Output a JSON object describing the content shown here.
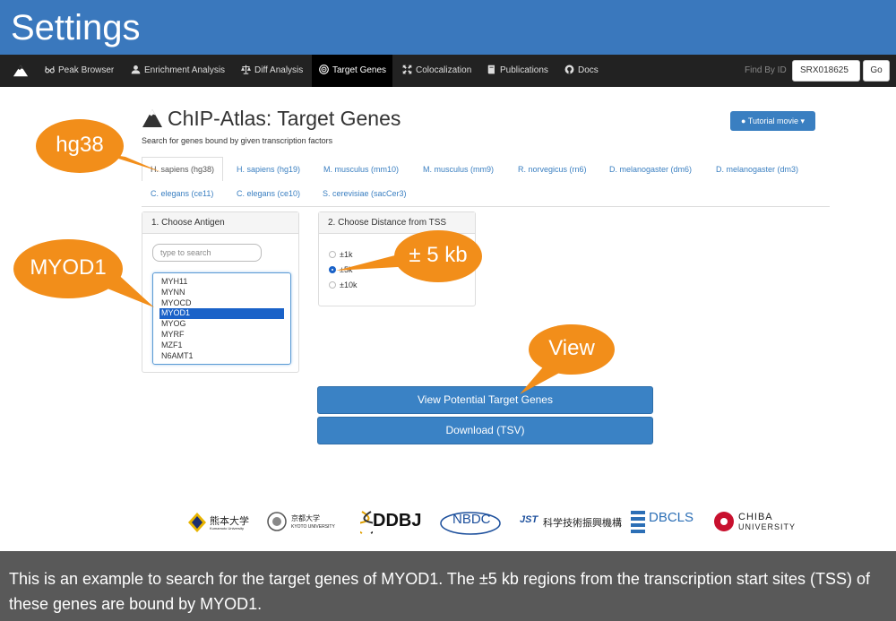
{
  "banner": {
    "title": "Settings"
  },
  "nav": {
    "items": [
      {
        "label": "Peak Browser",
        "icon": "glasses-icon"
      },
      {
        "label": "Enrichment Analysis",
        "icon": "user-icon"
      },
      {
        "label": "Diff Analysis",
        "icon": "scale-icon"
      },
      {
        "label": "Target Genes",
        "icon": "target-icon"
      },
      {
        "label": "Colocalization",
        "icon": "arrows-icon"
      },
      {
        "label": "Publications",
        "icon": "book-icon"
      },
      {
        "label": "Docs",
        "icon": "github-icon"
      }
    ],
    "active_index": 3,
    "find_by_id_label": "Find By ID",
    "find_by_id_value": "SRX018625",
    "go_label": "Go"
  },
  "header": {
    "title": "ChIP-Atlas: Target Genes",
    "subtitle": "Search for genes bound by given transcription factors",
    "tutorial_label": "Tutorial movie"
  },
  "tabs": [
    "H. sapiens (hg38)",
    "H. sapiens (hg19)",
    "M. musculus (mm10)",
    "M. musculus (mm9)",
    "R. norvegicus (rn6)",
    "D. melanogaster (dm6)",
    "D. melanogaster (dm3)",
    "C. elegans (ce11)",
    "C. elegans (ce10)",
    "S. cerevisiae (sacCer3)"
  ],
  "antigen_panel": {
    "heading": "1. Choose Antigen",
    "search_placeholder": "type to search",
    "options": [
      "MYH11",
      "MYNN",
      "MYOCD",
      "MYOD1",
      "MYOG",
      "MYRF",
      "MZF1",
      "N6AMT1"
    ],
    "selected": "MYOD1"
  },
  "distance_panel": {
    "heading": "2. Choose Distance from TSS",
    "options": [
      "±1k",
      "±5k",
      "±10k"
    ],
    "selected": "±5k"
  },
  "actions": {
    "view_label": "View Potential Target Genes",
    "download_label": "Download (TSV)"
  },
  "callouts": {
    "genome": "hg38",
    "antigen": "MYOD1",
    "distance": "± 5 kb",
    "view": "View"
  },
  "logos": [
    {
      "name": "kumamoto-logo",
      "text": "熊本大学",
      "sub": "Kumamoto University"
    },
    {
      "name": "kyoto-logo",
      "text": "京都大学",
      "sub": "KYOTO UNIVERSITY"
    },
    {
      "name": "ddbj-logo",
      "text": "DDBJ"
    },
    {
      "name": "nbdc-logo",
      "text": "NBDC"
    },
    {
      "name": "jst-logo",
      "text": "科学技術振興機構"
    },
    {
      "name": "dbcls-logo",
      "text": "DBCLS"
    },
    {
      "name": "chiba-logo",
      "text": "CHIBA",
      "sub": "UNIVERSITY"
    }
  ],
  "caption": "This is an example to search for the target genes of MYOD1. The ±5 kb regions from the transcription start sites (TSS) of these genes are bound by MYOD1.",
  "colors": {
    "banner": "#3a78bd",
    "accent": "#3a82c5",
    "callout": "#f28e1a",
    "navbar": "#222222",
    "caption_bg": "#595959"
  }
}
